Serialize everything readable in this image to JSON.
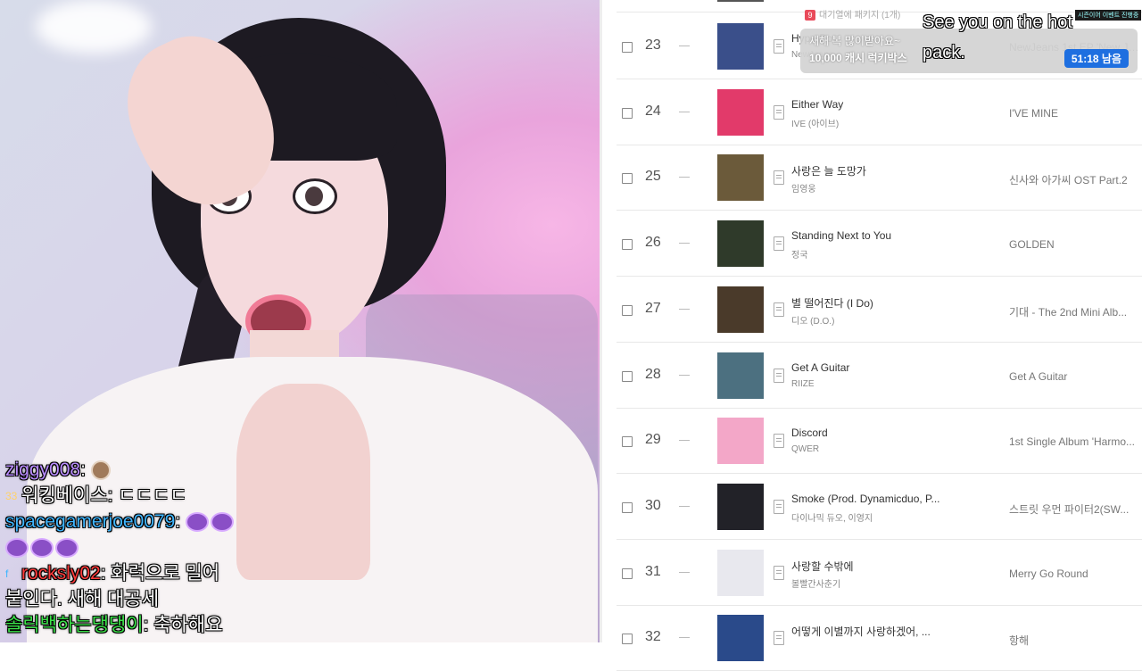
{
  "chat": [
    {
      "user": "ziggy008",
      "color": "#b98cff",
      "message": ":",
      "emote": "dog-emote"
    },
    {
      "user": "워킹베이스",
      "color": "#ffffff",
      "badge": "33",
      "message": ": ㄷㄷㄷㄷ"
    },
    {
      "user": "spacegamerjoe0079",
      "color": "#3fb6ff",
      "message": ":",
      "emote": "purple-emote"
    },
    {
      "user": "rocksly02",
      "color": "#ff3b3b",
      "badge": "f",
      "message": ": 화력으로 밀어",
      "continuation": "붙인다. 새해 대공세"
    },
    {
      "user": "솔릭백하는댕댕이",
      "color": "#3be24a",
      "message": ": 축하해요"
    }
  ],
  "chart": {
    "rows": [
      {
        "rank": "23",
        "title": "Hype Boy",
        "artist": "NewJeans",
        "album": "NewJeans 1st EP 'New Je...",
        "cover": "#3a4f8a"
      },
      {
        "rank": "24",
        "title": "Either Way",
        "artist": "IVE (아이브)",
        "album": "I'VE MINE",
        "cover": "#e23a6a"
      },
      {
        "rank": "25",
        "title": "사랑은 늘 도망가",
        "artist": "임영웅",
        "album": "신사와 아가씨 OST Part.2",
        "cover": "#6b5a3a"
      },
      {
        "rank": "26",
        "title": "Standing Next to You",
        "artist": "정국",
        "album": "GOLDEN",
        "cover": "#2f3a2a"
      },
      {
        "rank": "27",
        "title": "별 떨어진다 (I Do)",
        "artist": "디오 (D.O.)",
        "album": "기대 - The 2nd Mini Alb...",
        "cover": "#4a3a2a"
      },
      {
        "rank": "28",
        "title": "Get A Guitar",
        "artist": "RIIZE",
        "album": "Get A Guitar",
        "cover": "#4c7080"
      },
      {
        "rank": "29",
        "title": "Discord",
        "artist": "QWER",
        "album": "1st Single Album 'Harmo...",
        "cover": "#f3a7c8"
      },
      {
        "rank": "30",
        "title": "Smoke (Prod. Dynamicduo, P...",
        "artist": "다이나믹 듀오, 이영지",
        "album": "스트릿 우먼 파이터2(SW...",
        "cover": "#222228"
      },
      {
        "rank": "31",
        "title": "사랑할 수밖에",
        "artist": "볼빨간사춘기",
        "album": "Merry Go Round",
        "cover": "#e8e8ee"
      },
      {
        "rank": "32",
        "title": "어떻게 이별까지 사랑하겠어, ...",
        "artist": "",
        "album": "항해",
        "cover": "#2a4a8a"
      }
    ]
  },
  "donation": {
    "message": "새해 복 많이받아요~",
    "amount": "10,000 캐시 럭키박스",
    "timer": "51:18 남음"
  },
  "top_notice": {
    "badge": "9",
    "text": "대기열에 패키지 (1개)"
  },
  "event_tag": "시즌이어 이벤트 진행중",
  "caption": "See you on the hot pack."
}
